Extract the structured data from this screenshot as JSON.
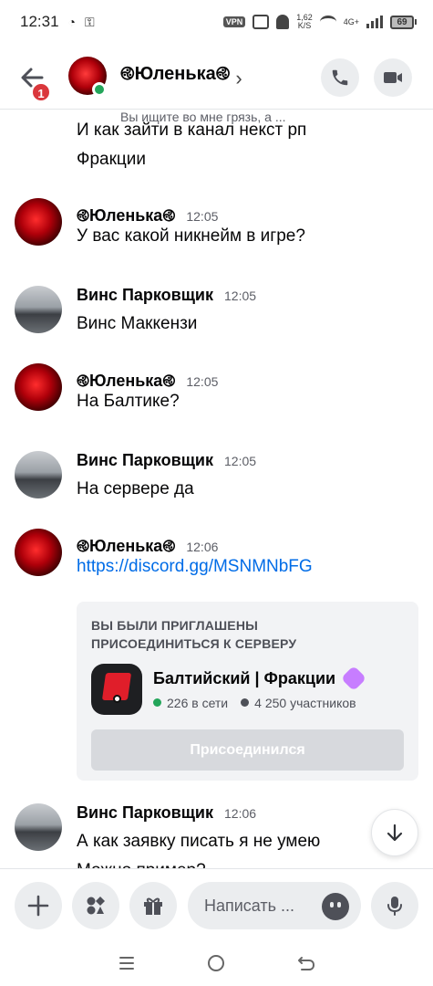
{
  "status_bar": {
    "time": "12:31",
    "net_speed": "1,62\nK/S",
    "net_type": "4G+",
    "vpn": "VPN",
    "battery": "69"
  },
  "header": {
    "unread_badge": "1",
    "title": "࿋Юленька࿋",
    "chevron": "›",
    "status": "Вы ищите во мне грязь, а ..."
  },
  "messages": {
    "continued": {
      "lines": [
        "И как зайти в канал некст рп",
        "Фракции"
      ]
    },
    "m1": {
      "author": "࿋Юленька࿋",
      "time": "12:05",
      "text": "У вас какой никнейм в игре?"
    },
    "m2": {
      "author": "Винс Парковщик",
      "time": "12:05",
      "text": "Винс Маккензи"
    },
    "m3": {
      "author": "࿋Юленька࿋",
      "time": "12:05",
      "text": "На Балтике?"
    },
    "m4": {
      "author": "Винс Парковщик",
      "time": "12:05",
      "text": "На сервере да"
    },
    "m5": {
      "author": "࿋Юленька࿋",
      "time": "12:06",
      "link": "https://discord.gg/MSNMNbFG"
    },
    "m6": {
      "author": "Винс Парковщик",
      "time": "12:06",
      "text": "А как заявку писать я не умею",
      "text2": "Можно пример?"
    }
  },
  "invite": {
    "title_line1": "ВЫ БЫЛИ ПРИГЛАШЕНЫ",
    "title_line2": "ПРИСОЕДИНИТЬСЯ К СЕРВЕРУ",
    "server_name": "Балтийский | Фракции",
    "online": "226 в сети",
    "members": "4 250 участников",
    "button": "Присоединился"
  },
  "composer": {
    "placeholder": "Написать ..."
  },
  "colors": {
    "online": "#23a55a",
    "badge": "#da373c",
    "link": "#006ce7",
    "boost": "#c77dff"
  }
}
